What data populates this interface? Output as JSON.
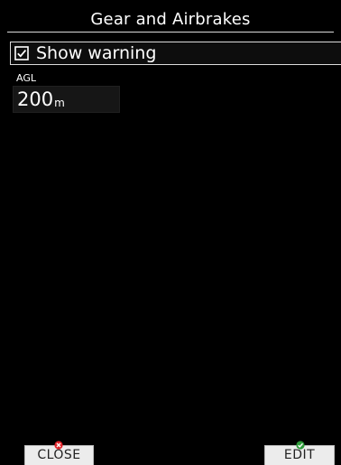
{
  "header": {
    "title": "Gear and Airbrakes"
  },
  "warning": {
    "label": "Show warning",
    "checked": true,
    "icon": "checkbox-checked-icon"
  },
  "agl": {
    "label": "AGL",
    "value": "200",
    "unit": "m"
  },
  "footer": {
    "close_label": "CLOSE",
    "close_icon": "close-x-icon",
    "close_icon_color": "#e0242a",
    "edit_label": "EDIT",
    "edit_icon": "check-icon",
    "edit_icon_color": "#2e9b3a"
  },
  "colors": {
    "background": "#000000",
    "text": "#ffffff",
    "button_face": "#ececec"
  }
}
